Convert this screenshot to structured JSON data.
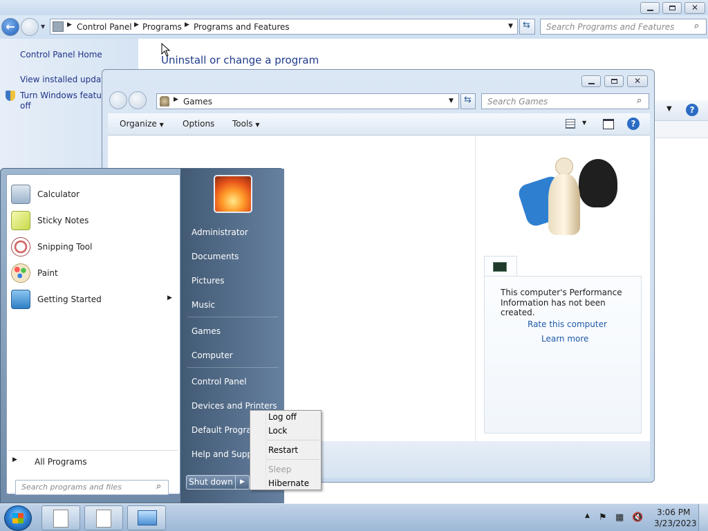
{
  "programs_features": {
    "breadcrumbs": [
      "Control Panel",
      "Programs",
      "Programs and Features"
    ],
    "search_placeholder": "Search Programs and Features",
    "sidebar": {
      "home": "Control Panel Home",
      "installed_updates": "View installed updates",
      "turn_features_line1": "Turn Windows feature",
      "turn_features_line2": "off"
    },
    "heading": "Uninstall or change a program"
  },
  "games_window": {
    "address": "Games",
    "search_placeholder": "Search Games",
    "toolbar": {
      "organize": "Organize",
      "options": "Options",
      "tools": "Tools"
    },
    "performance_line1": "This computer's Performance",
    "performance_line2": "Information has not been created.",
    "rate_link": "Rate this computer",
    "learn_link": "Learn more"
  },
  "start_menu": {
    "programs": [
      {
        "label": "Calculator",
        "icon": "calculator-icon",
        "color": "#9ab3cc"
      },
      {
        "label": "Sticky Notes",
        "icon": "sticky-notes-icon",
        "color": "#d9e86a"
      },
      {
        "label": "Snipping Tool",
        "icon": "snipping-tool-icon",
        "color": "#d46a6a"
      },
      {
        "label": "Paint",
        "icon": "paint-icon",
        "color": "#6fb7e0"
      },
      {
        "label": "Getting Started",
        "icon": "getting-started-icon",
        "color": "#5fa7d8"
      }
    ],
    "all_programs": "All Programs",
    "search_placeholder": "Search programs and files",
    "right_items": {
      "administrator": "Administrator",
      "documents": "Documents",
      "pictures": "Pictures",
      "music": "Music",
      "games": "Games",
      "computer": "Computer",
      "control_panel": "Control Panel",
      "devices_printers": "Devices and Printers",
      "default_programs": "Default Programs",
      "help_support": "Help and Support"
    },
    "shutdown": "Shut down"
  },
  "shutdown_menu": {
    "log_off": "Log off",
    "lock": "Lock",
    "restart": "Restart",
    "sleep": "Sleep",
    "hibernate": "Hibernate"
  },
  "taskbar": {
    "time": "3:06 PM",
    "date": "3/23/2023"
  }
}
